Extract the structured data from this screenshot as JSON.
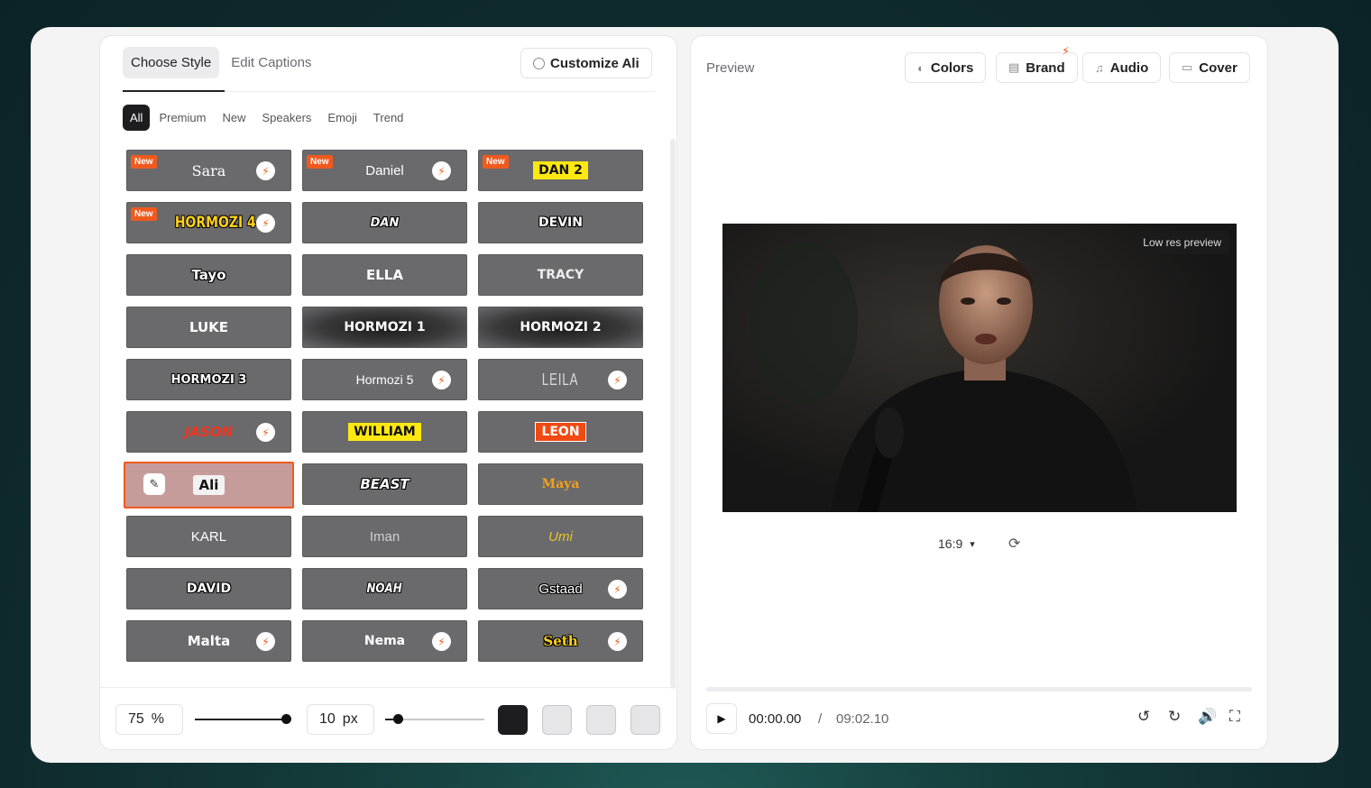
{
  "left": {
    "tabs": [
      "Choose Style",
      "Edit Captions"
    ],
    "customize_label": "Customize Ali",
    "filters": [
      "All",
      "Premium",
      "New",
      "Speakers",
      "Emoji",
      "Trend"
    ],
    "styles": [
      {
        "label": "Sara",
        "new": true,
        "premium": true
      },
      {
        "label": "Daniel",
        "new": true,
        "premium": true
      },
      {
        "label": "DAN 2",
        "new": true,
        "premium": false
      },
      {
        "label": "HORMOZI 4",
        "new": true,
        "premium": true
      },
      {
        "label": "DAN",
        "new": false,
        "premium": false
      },
      {
        "label": "DEVIN",
        "new": false,
        "premium": false
      },
      {
        "label": "Tayo",
        "new": false,
        "premium": false
      },
      {
        "label": "ELLA",
        "new": false,
        "premium": false
      },
      {
        "label": "TRACY",
        "new": false,
        "premium": false
      },
      {
        "label": "LUKE",
        "new": false,
        "premium": false
      },
      {
        "label": "HORMOZI 1",
        "new": false,
        "premium": false
      },
      {
        "label": "HORMOZI 2",
        "new": false,
        "premium": false
      },
      {
        "label": "HORMOZI 3",
        "new": false,
        "premium": false
      },
      {
        "label": "Hormozi 5",
        "new": false,
        "premium": true
      },
      {
        "label": "LEILA",
        "new": false,
        "premium": true
      },
      {
        "label": "JASON",
        "new": false,
        "premium": true
      },
      {
        "label": "WILLIAM",
        "new": false,
        "premium": false
      },
      {
        "label": "LEON",
        "new": false,
        "premium": false
      },
      {
        "label": "Ali",
        "new": false,
        "premium": false,
        "selected": true
      },
      {
        "label": "BEAST",
        "new": false,
        "premium": false
      },
      {
        "label": "Maya",
        "new": false,
        "premium": false
      },
      {
        "label": "KARL",
        "new": false,
        "premium": false
      },
      {
        "label": "Iman",
        "new": false,
        "premium": false
      },
      {
        "label": "Umi",
        "new": false,
        "premium": false
      },
      {
        "label": "DAVID",
        "new": false,
        "premium": false
      },
      {
        "label": "NOAH",
        "new": false,
        "premium": false
      },
      {
        "label": "Gstaad",
        "new": false,
        "premium": true
      },
      {
        "label": "Malta",
        "new": false,
        "premium": true
      },
      {
        "label": "Nema",
        "new": false,
        "premium": true
      },
      {
        "label": "Seth",
        "new": false,
        "premium": true
      }
    ],
    "new_badge": "New",
    "size_value": "75",
    "size_unit": "%",
    "stroke_value": "10",
    "stroke_unit": "px",
    "swatches": [
      "#1d1d1f",
      "#e6e6e8",
      "#e6e6e8",
      "#e6e6e8"
    ]
  },
  "right": {
    "title": "Preview",
    "buttons": [
      "Colors",
      "Brand",
      "Audio",
      "Cover"
    ],
    "low_res_label": "Low res preview",
    "aspect_ratio": "16:9",
    "time_current": "00:00.00",
    "time_separator": "/",
    "time_total": "09:02.10"
  },
  "colors": {
    "accent": "#f05a1e",
    "tile": "#6a6a6c",
    "selected_tile": "#c59c9a"
  }
}
